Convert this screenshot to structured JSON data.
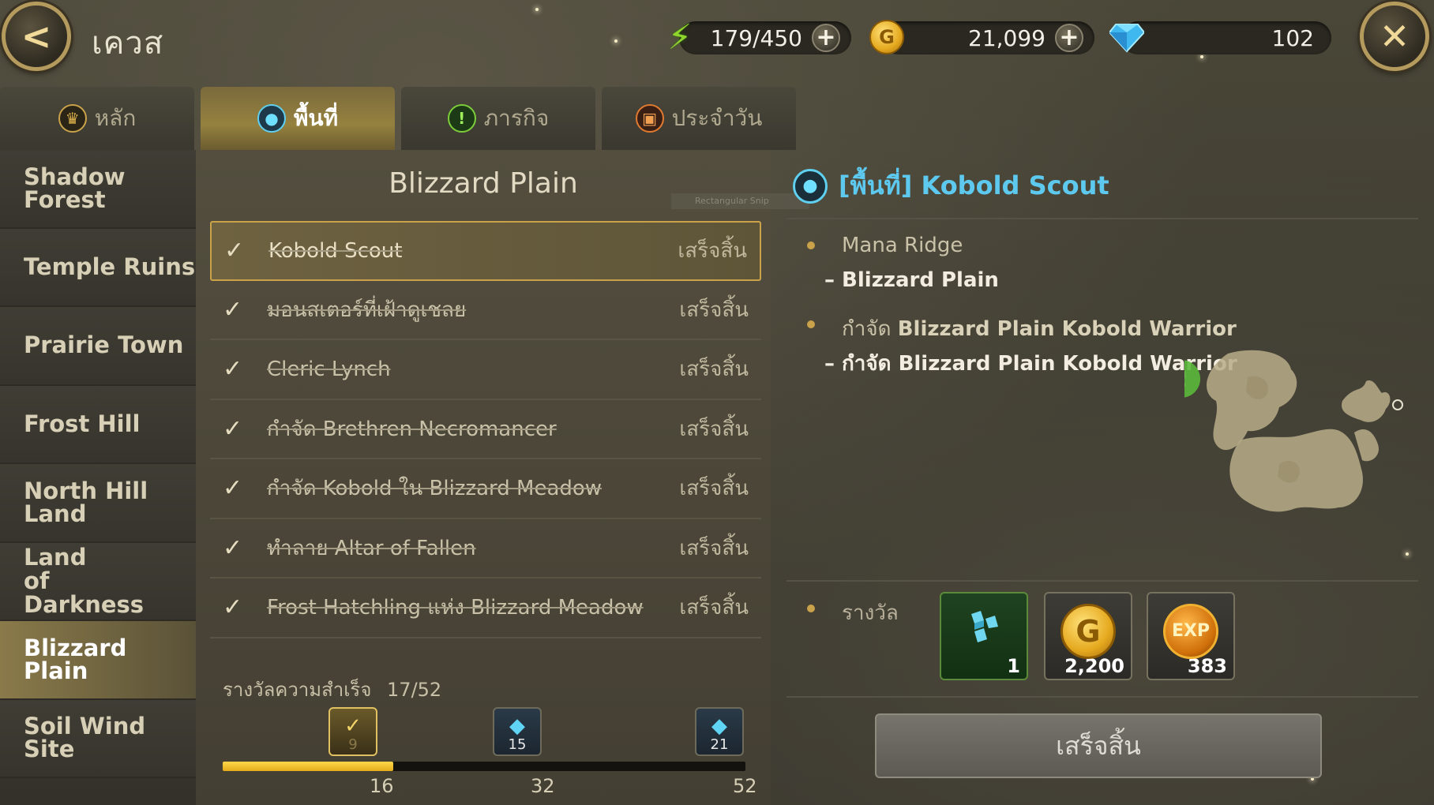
{
  "header": {
    "title": "เควส",
    "energy": "179/450",
    "gold": "21,099",
    "gems": "102",
    "plus_symbol": "+",
    "back_symbol": "<",
    "close_symbol": "✕"
  },
  "tabs": [
    {
      "label": "หลัก",
      "icon": "crown-icon"
    },
    {
      "label": "พื้นที่",
      "icon": "map-pin-icon"
    },
    {
      "label": "ภารกิจ",
      "icon": "exclamation-icon"
    },
    {
      "label": "ประจำวัน",
      "icon": "calendar-icon"
    }
  ],
  "active_tab": 1,
  "sidebar": {
    "items": [
      {
        "label": "Shadow Forest"
      },
      {
        "label": "Temple Ruins"
      },
      {
        "label": "Prairie Town"
      },
      {
        "label": "Frost Hill"
      },
      {
        "label": "North Hill Land"
      },
      {
        "label": "Land of Darkness"
      },
      {
        "label": "Blizzard Plain"
      },
      {
        "label": "Soil Wind Site"
      }
    ],
    "active_index": 6
  },
  "quest_list": {
    "title": "Blizzard Plain",
    "status_label": "เสร็จสิ้น",
    "check_symbol": "✓",
    "quests": [
      {
        "name": "Kobold Scout",
        "status": "เสร็จสิ้น"
      },
      {
        "name": "มอนสเตอร์ที่เฝ้าดูเชลย",
        "status": "เสร็จสิ้น"
      },
      {
        "name": "Cleric Lynch",
        "status": "เสร็จสิ้น"
      },
      {
        "name": "กำจัด Brethren Necromancer",
        "status": "เสร็จสิ้น"
      },
      {
        "name": "กำจัด Kobold ใน Blizzard Meadow",
        "status": "เสร็จสิ้น"
      },
      {
        "name": "ทำลาย Altar of Fallen",
        "status": "เสร็จสิ้น"
      },
      {
        "name": "Frost Hatchling แห่ง Blizzard Meadow",
        "status": "เสร็จสิ้น"
      }
    ],
    "achievement_label": "รางวัลความสำเร็จ",
    "achievement_progress": "17/52",
    "progress_fraction": 0.327,
    "milestones": [
      {
        "threshold": "16",
        "reward": "9",
        "claimed": true
      },
      {
        "threshold": "32",
        "reward": "15",
        "claimed": false
      },
      {
        "threshold": "52",
        "reward": "21",
        "claimed": false
      }
    ]
  },
  "detail": {
    "title": "[พื้นที่] Kobold Scout",
    "location_main": "Mana Ridge",
    "location_sub": "– Blizzard Plain",
    "objective_prefix": "กำจัด",
    "objective_target": "Blizzard Plain Kobold Warrior",
    "objective_sub_prefix": "– กำจัด",
    "objective_sub_target": "Blizzard Plain Kobold Warrior",
    "reward_label": "รางวัล",
    "rewards": [
      {
        "icon": "cube-item-icon",
        "amount": "1"
      },
      {
        "icon": "gold-coin-icon",
        "amount": "2,200"
      },
      {
        "icon": "exp-icon",
        "amount": "383"
      }
    ],
    "exp_text": "EXP",
    "coin_text": "G",
    "done_button": "เสร็จสิ้น"
  },
  "overlay": {
    "snip_label": "Rectangular Snip"
  },
  "colors": {
    "accent_gold": "#caa24a",
    "title_blue": "#5ec9ef",
    "progress_fill": "#f0c22a"
  }
}
